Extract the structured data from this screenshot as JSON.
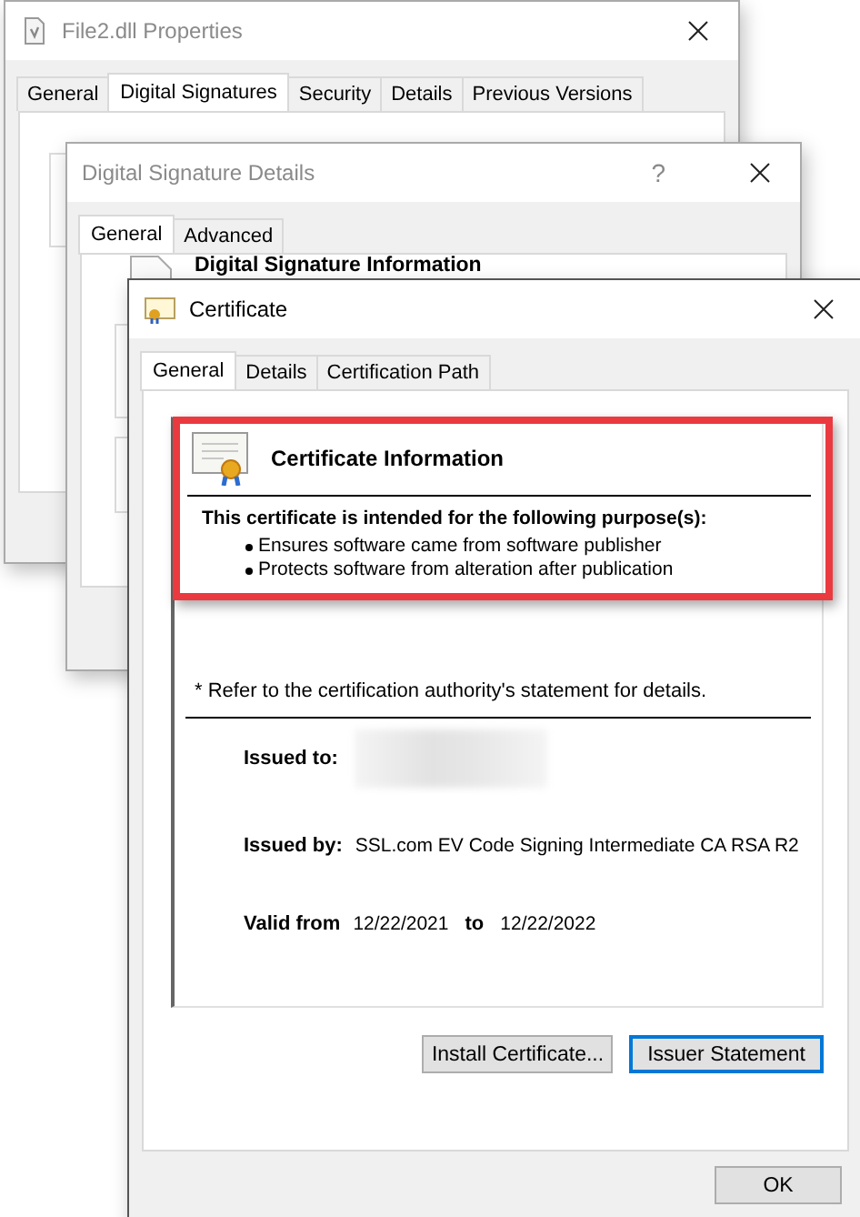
{
  "windows": [
    {
      "kind": "properties",
      "title": "File2.dll Properties",
      "tabs": [
        {
          "label": "General",
          "selected": false
        },
        {
          "label": "Digital Signatures",
          "selected": true
        },
        {
          "label": "Security",
          "selected": false
        },
        {
          "label": "Details",
          "selected": false
        },
        {
          "label": "Previous Versions",
          "selected": false
        }
      ]
    },
    {
      "kind": "signature_details",
      "title": "Digital Signature Details",
      "help_button": "?",
      "tabs": [
        {
          "label": "General",
          "selected": true
        },
        {
          "label": "Advanced",
          "selected": false
        }
      ],
      "heading": "Digital Signature Information"
    },
    {
      "kind": "certificate",
      "title": "Certificate",
      "tabs": [
        {
          "label": "General",
          "selected": true
        },
        {
          "label": "Details",
          "selected": false
        },
        {
          "label": "Certification Path",
          "selected": false
        }
      ],
      "info": {
        "heading": "Certificate Information",
        "highlighted": true,
        "purpose_title": "This certificate is intended for the following purpose(s):",
        "purposes": [
          "Ensures software came from software publisher",
          "Protects software from alteration after publication"
        ]
      },
      "note": "* Refer to the certification authority's statement for details.",
      "fields": [
        {
          "label": "Issued to:",
          "redacted": true
        },
        {
          "label": "Issued by:",
          "value": "SSL.com EV Code Signing Intermediate CA RSA R2"
        }
      ],
      "validity": {
        "label": "Valid from",
        "from": "12/22/2021",
        "to_label": "to",
        "to": "12/22/2022"
      },
      "buttons": [
        {
          "label": "Install Certificate...",
          "default": false
        },
        {
          "label": "Issuer Statement",
          "default": true
        }
      ],
      "ok": "OK"
    }
  ]
}
